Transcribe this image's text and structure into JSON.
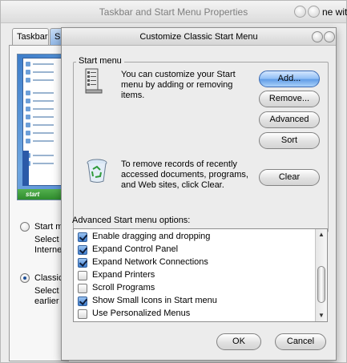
{
  "background_window": {
    "title": "Taskbar and Start Menu Properties",
    "title_overflow": "ne wit",
    "tabs": [
      "Taskbar",
      "S"
    ],
    "preview_start_label": "start",
    "radio_start_menu_label": "Start me",
    "radio_start_menu_desc_1": "Select",
    "radio_start_menu_desc_2": "Interne",
    "radio_classic_label": "Classic",
    "radio_classic_desc_1": "Select",
    "radio_classic_desc_2": "earlier v"
  },
  "dialog": {
    "title": "Customize Classic Start Menu",
    "start_menu_group": {
      "label": "Start menu",
      "description_lines": [
        "You can customize your Start",
        "menu by adding or removing",
        "items."
      ],
      "buttons": {
        "add": "Add...",
        "remove": "Remove...",
        "advanced": "Advanced",
        "sort": "Sort"
      },
      "clear_description_lines": [
        "To remove records of recently",
        "accessed documents, programs,",
        "and Web sites, click Clear."
      ],
      "clear_button": "Clear"
    },
    "advanced_options_label": "Advanced Start menu options:",
    "options": [
      {
        "label": "Enable dragging and dropping",
        "checked": true
      },
      {
        "label": "Expand Control Panel",
        "checked": true
      },
      {
        "label": "Expand Network Connections",
        "checked": true
      },
      {
        "label": "Expand Printers",
        "checked": false
      },
      {
        "label": "Scroll Programs",
        "checked": false
      },
      {
        "label": "Show Small Icons in Start menu",
        "checked": true
      },
      {
        "label": "Use Personalized Menus",
        "checked": false
      }
    ],
    "ok_button": "OK",
    "cancel_button": "Cancel"
  },
  "colors": {
    "default_button": "#5e9be6",
    "checkbox_checked": "#3f7fd0",
    "window_bg": "#ececec"
  }
}
